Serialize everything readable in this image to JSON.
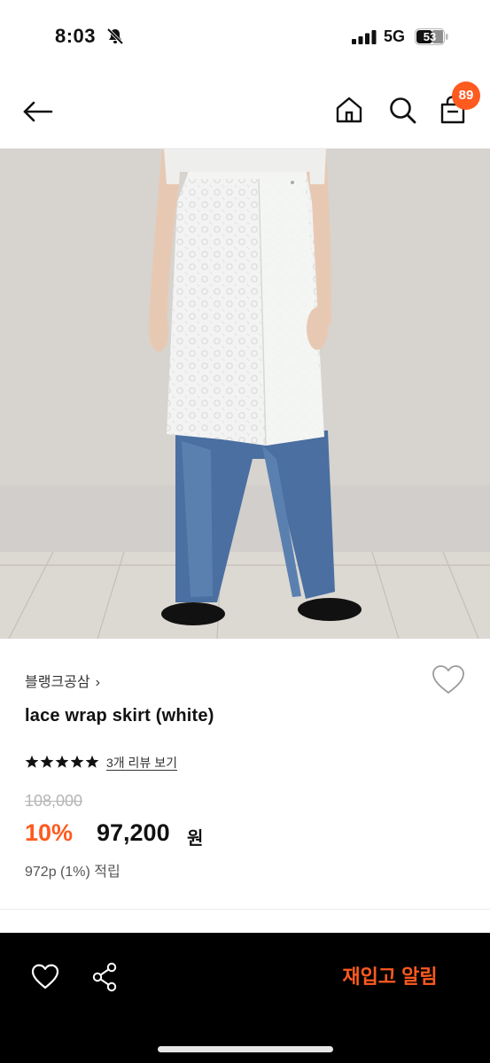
{
  "status_bar": {
    "time": "8:03",
    "network": "5G",
    "battery": "53"
  },
  "header": {
    "cart_count": "89"
  },
  "product": {
    "brand": "블랭크공삼",
    "title": "lace wrap skirt (white)",
    "rating_stars": 5,
    "review_link": "3개 리뷰 보기",
    "price_original": "108,000",
    "discount_rate": "10%",
    "price_final": "97,200",
    "price_unit": "원",
    "points": "972p (1%) 적립"
  },
  "bottom_bar": {
    "restock_label": "재입고 알림"
  },
  "colors": {
    "accent": "#ff5a1f",
    "bottom_bar": "#000000",
    "wall": "#d8d5d1",
    "floor": "#dcd8d2",
    "denim": "#4a6fa0"
  },
  "icons": [
    "bell-off-icon",
    "back-arrow-icon",
    "home-icon",
    "search-icon",
    "cart-icon",
    "heart-outline-icon",
    "star-icon",
    "share-icon"
  ]
}
